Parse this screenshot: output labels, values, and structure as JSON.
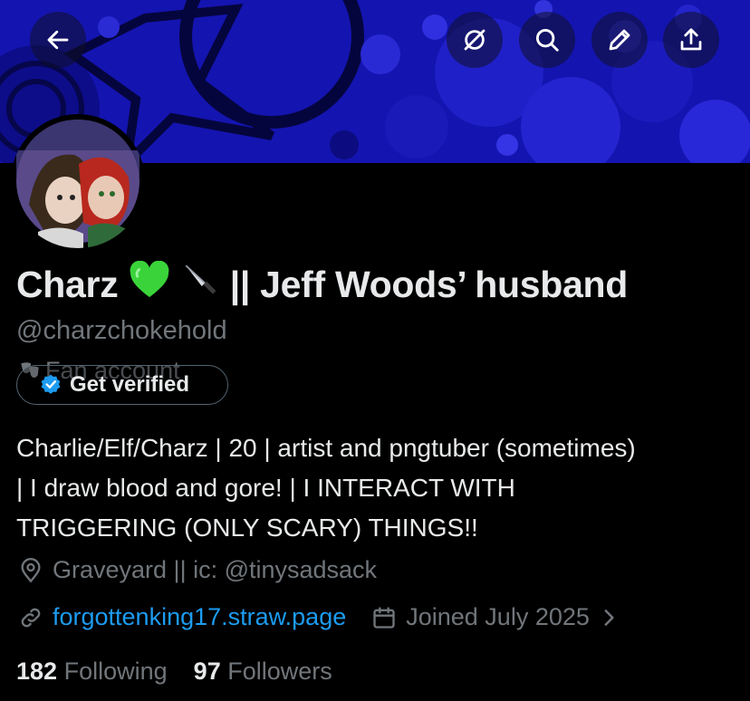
{
  "header": {
    "back_icon": "arrow-left-icon",
    "actions": [
      "grok-icon",
      "search-icon",
      "pencil-icon",
      "share-icon"
    ]
  },
  "profile": {
    "name": "Charz",
    "name_suffix": "|| Jeff Woods’ husband",
    "name_emojis": [
      "green-heart",
      "knife"
    ],
    "handle": "@charzchokehold",
    "category": "Fan account",
    "verify_label": "Get verified",
    "bio": "Charlie/Elf/Charz | 20 | artist and pngtuber (sometimes)\n| I draw blood and gore! | I INTERACT WITH\nTRIGGERING (ONLY SCARY) THINGS!!",
    "location": "Graveyard  || ic: @tinysadsack",
    "website": "forgottenking17.straw.page",
    "joined": "Joined July 2025"
  },
  "stats": {
    "following_count": "182",
    "following_label": "Following",
    "followers_count": "97",
    "followers_label": "Followers"
  },
  "colors": {
    "background": "#000000",
    "banner": "#1212a8",
    "text": "#e7e9ea",
    "muted": "#71767b",
    "link": "#1d9bf0",
    "verified_badge": "#1d9bf0"
  }
}
